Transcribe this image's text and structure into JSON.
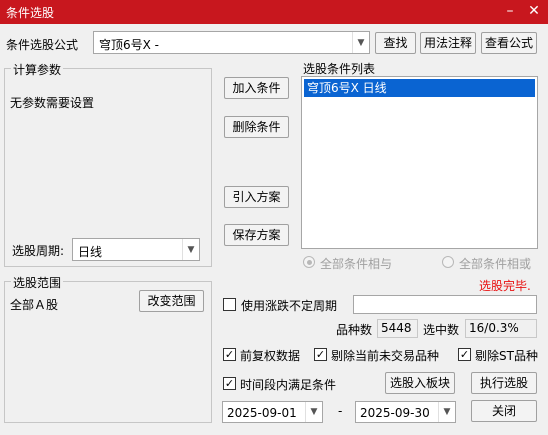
{
  "window": {
    "title": "条件选股",
    "minimize": "–",
    "close": "✕"
  },
  "formula": {
    "label": "条件选股公式",
    "value": "穹顶6号X  -",
    "find_label": "查找",
    "usage_label": "用法注释",
    "view_label": "查看公式"
  },
  "params": {
    "legend": "计算参数",
    "message": "无参数需要设置",
    "period_label": "选股周期:",
    "period_value": "日线"
  },
  "buttons": {
    "add": "加入条件",
    "delete": "删除条件",
    "import": "引入方案",
    "save": "保存方案",
    "change_range": "改变范围",
    "select_to_block": "选股入板块",
    "execute": "执行选股",
    "close": "关闭"
  },
  "conditions": {
    "title": "选股条件列表",
    "items": [
      "穹顶6号X  日线"
    ]
  },
  "logic": {
    "and_label": "全部条件相与",
    "or_label": "全部条件相或"
  },
  "status": {
    "message": "选股完毕.",
    "color": "#e81010"
  },
  "range": {
    "legend": "选股范围",
    "value": "全部Ａ股"
  },
  "options": {
    "irregular_period": {
      "label": "使用涨跌不定周期",
      "checked": false,
      "value": ""
    },
    "adjusted": {
      "label": "前复权数据",
      "checked": true
    },
    "exclude_untraded": {
      "label": "剔除当前未交易品种",
      "checked": true
    },
    "exclude_st": {
      "label": "剔除ST品种",
      "checked": true
    },
    "time_period": {
      "label": "时间段内满足条件",
      "checked": true
    }
  },
  "stats": {
    "count_label": "品种数",
    "count_value": "5448",
    "selected_label": "选中数",
    "selected_value": "16/0.3%"
  },
  "dates": {
    "start": "2025-09-01",
    "separator": "-",
    "end": "2025-09-30"
  },
  "colors": {
    "titlebar": "#c8171e",
    "selection": "#0a64d2"
  }
}
